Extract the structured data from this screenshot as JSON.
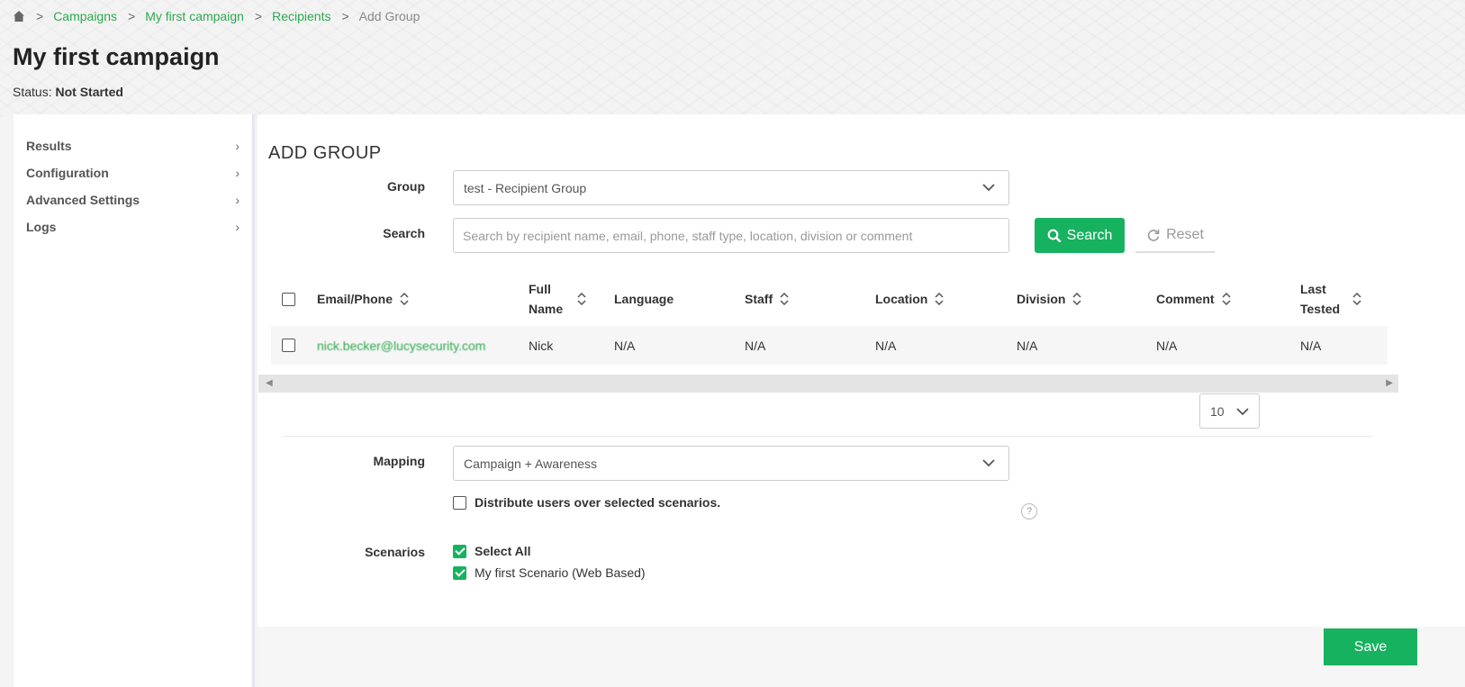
{
  "breadcrumb": {
    "home_icon": "home-icon",
    "items": [
      "Campaigns",
      "My first campaign",
      "Recipients"
    ],
    "current": "Add Group",
    "separator": ">"
  },
  "page": {
    "title": "My first campaign",
    "status_label": "Status:",
    "status_value": "Not Started"
  },
  "sidebar": {
    "items": [
      {
        "label": "Results"
      },
      {
        "label": "Configuration"
      },
      {
        "label": "Advanced Settings"
      },
      {
        "label": "Logs"
      }
    ]
  },
  "main": {
    "section_title": "ADD GROUP",
    "group_label": "Group",
    "group_value": "test - Recipient Group",
    "search_label": "Search",
    "search_placeholder": "Search by recipient name, email, phone, staff type, location, division or comment",
    "search_button": "Search",
    "reset_button": "Reset",
    "table": {
      "columns": [
        "Email/Phone",
        "Full Name",
        "Language",
        "Staff",
        "Location",
        "Division",
        "Comment",
        "Last Tested"
      ],
      "rows": [
        {
          "email": "nick.becker@lucysecurity.com",
          "full_name": "Nick",
          "language": "N/A",
          "staff": "N/A",
          "location": "N/A",
          "division": "N/A",
          "comment": "N/A",
          "last_tested": "N/A"
        }
      ]
    },
    "page_size": "10",
    "mapping_label": "Mapping",
    "mapping_value": "Campaign + Awareness",
    "distribute_label": "Distribute users over selected scenarios.",
    "help_label": "?",
    "scenarios_label": "Scenarios",
    "select_all_label": "Select All",
    "scenario_1_label": "My first Scenario (Web Based)",
    "save_button": "Save"
  },
  "colors": {
    "accent": "#17b260",
    "link": "#2ea84f"
  }
}
